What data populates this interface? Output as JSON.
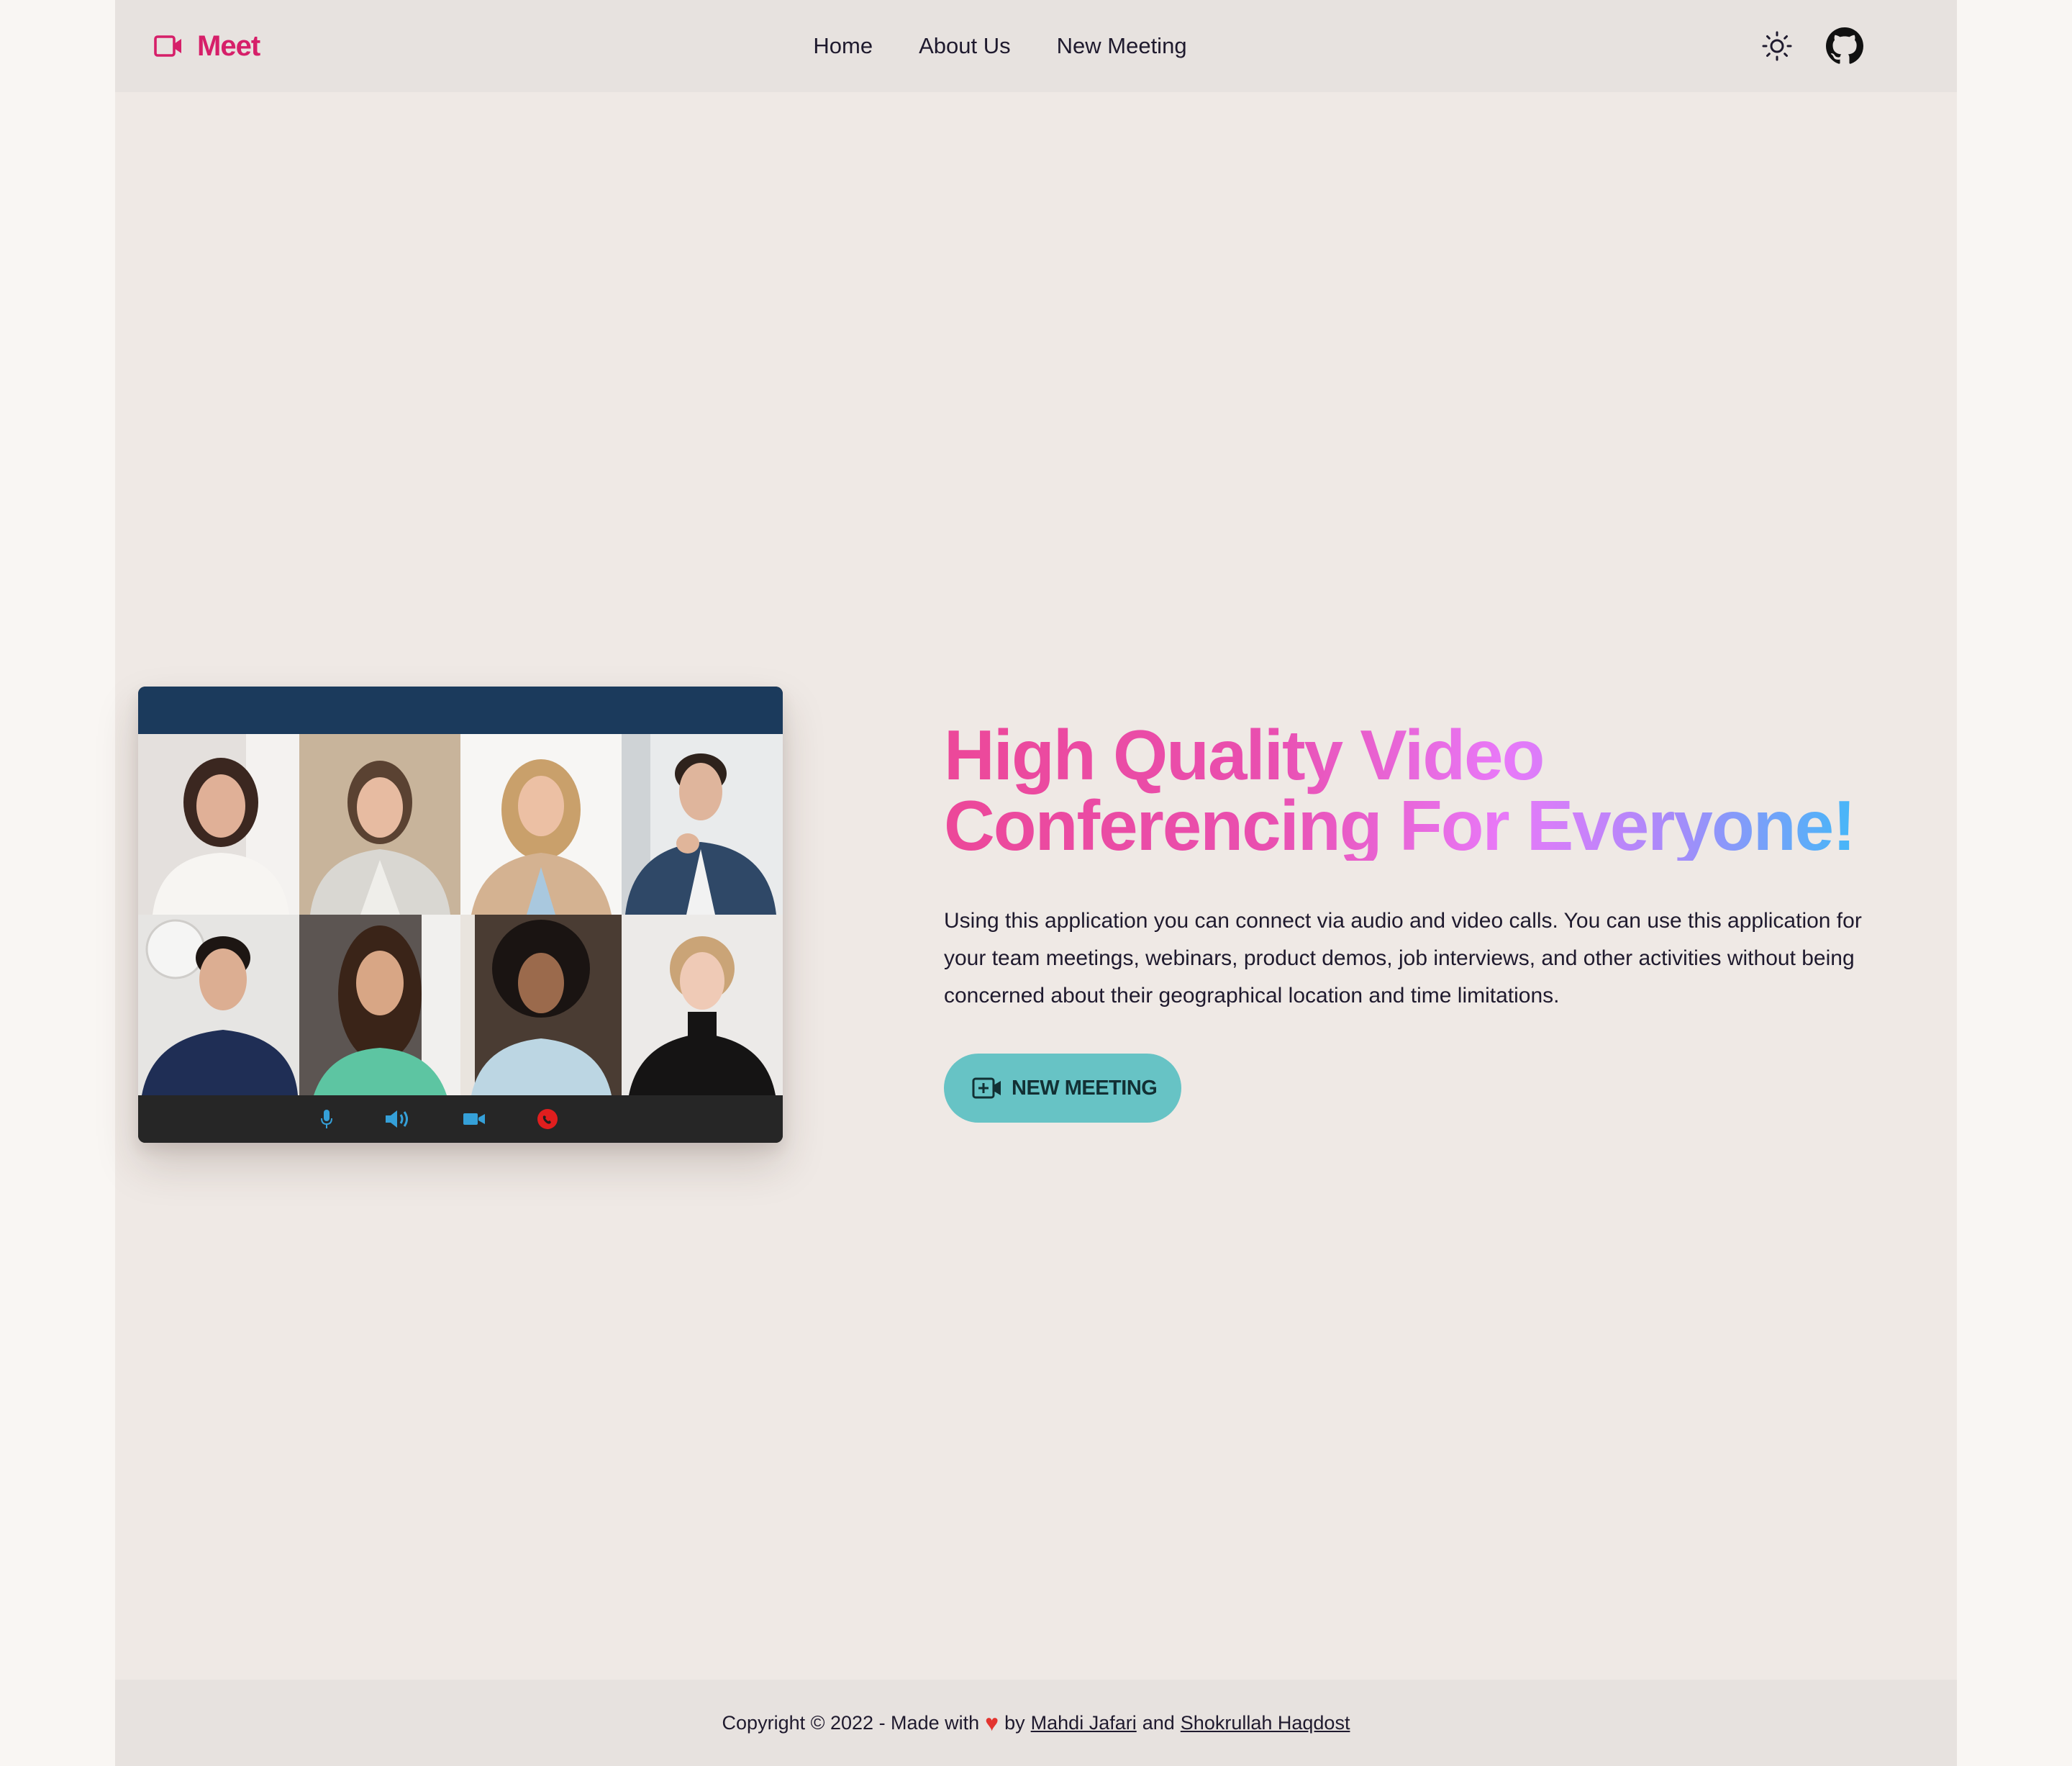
{
  "brand": {
    "name": "Meet",
    "color": "#d61f69"
  },
  "nav": {
    "items": [
      "Home",
      "About Us",
      "New Meeting"
    ]
  },
  "header_icons": {
    "theme_toggle": "sun-icon",
    "repo_link": "github-icon"
  },
  "hero": {
    "title_line1": "High Quality Video",
    "title_line2": "Conferencing For Everyone!",
    "description": "Using this application you can connect via audio and video calls. You can use this application for your team meetings, webinars, product demos, job interviews, and other activities without being concerned about their geographical location and time limitations.",
    "cta_label": "NEW MEETING",
    "cta_color": "#67c3c5",
    "gradient_colors": [
      "#ec4899",
      "#e879f9",
      "#a78bfa",
      "#38bdf8"
    ]
  },
  "video_preview": {
    "participants": 8,
    "controls": [
      "microphone-icon",
      "speaker-icon",
      "camera-icon",
      "hang-up-icon"
    ]
  },
  "footer": {
    "prefix": "Copyright © 2022 - Made with",
    "heart": "♥",
    "by": "by",
    "author1": "Mahdi Jafari",
    "and": "and",
    "author2": "Shokrullah Haqdost"
  }
}
